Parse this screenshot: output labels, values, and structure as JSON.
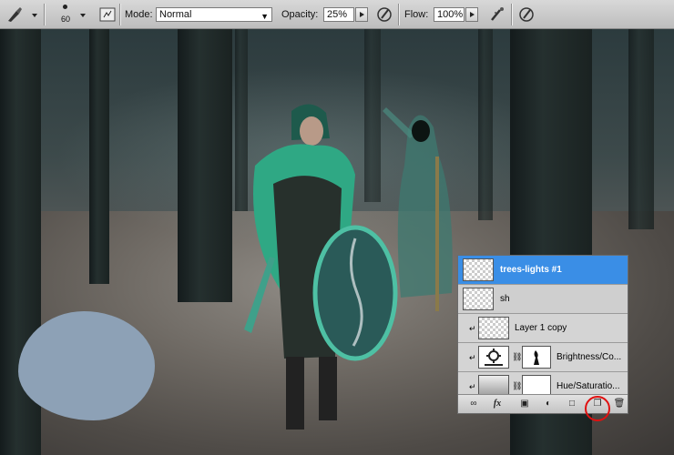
{
  "options_bar": {
    "brush_size": "60",
    "mode_label": "Mode:",
    "mode_value": "Normal",
    "opacity_label": "Opacity:",
    "opacity_value": "25%",
    "flow_label": "Flow:",
    "flow_value": "100%"
  },
  "canvas": {
    "blob_color": "#8da1b6"
  },
  "layers_panel": {
    "layers": [
      {
        "name": "trees-lights #1",
        "selected": true
      },
      {
        "name": "sh"
      },
      {
        "name": "Layer 1 copy"
      },
      {
        "name": "Brightness/Co..."
      },
      {
        "name": "Hue/Saturatio..."
      }
    ],
    "bottom_icons": [
      "link-icon",
      "fx-icon",
      "mask-icon",
      "adjustment-icon",
      "group-icon",
      "new-layer-icon",
      "trash-icon"
    ]
  },
  "colors": {
    "selection": "#3a8ee6",
    "highlight_circle": "#e01010"
  }
}
